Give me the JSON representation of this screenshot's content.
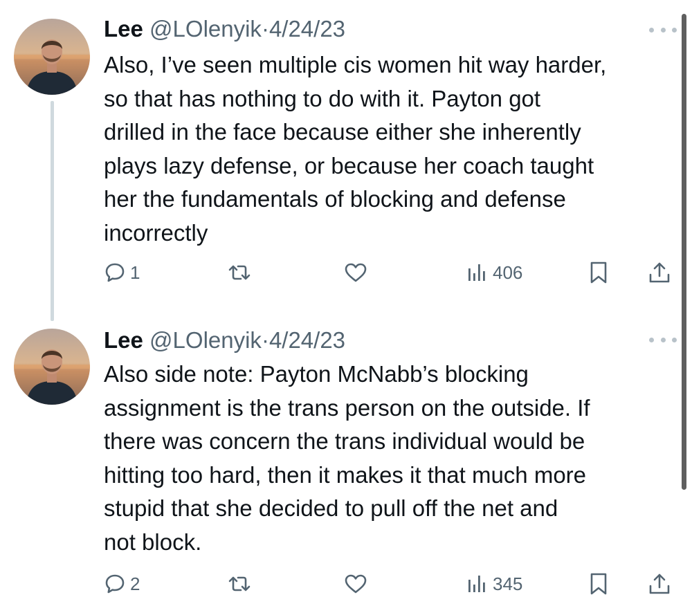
{
  "tweets": [
    {
      "author": {
        "name": "Lee",
        "handle": "@LOlenyik",
        "separator": "·",
        "date": "4/24/23"
      },
      "text": "Also, I’ve seen multiple cis women hit way harder,\nso that has nothing to do with it. Payton got\ndrilled in the face because either she inherently\nplays lazy defense, or because her coach taught\nher the fundamentals of blocking and defense\nincorrectly",
      "stats": {
        "replies": "1",
        "views": "406"
      }
    },
    {
      "author": {
        "name": "Lee",
        "handle": "@LOlenyik",
        "separator": "·",
        "date": "4/24/23"
      },
      "text": "Also side note: Payton McNabb’s blocking\nassignment is the trans person on the outside. If\nthere was concern the trans individual would be\nhitting too hard, then it makes it that much more\nstupid that she decided to pull off the net and\nnot block.",
      "stats": {
        "replies": "2",
        "views": "345"
      }
    }
  ],
  "icons": {
    "reply": "speech-bubble-icon",
    "retweet": "retweet-arrows-icon",
    "like": "heart-outline-icon",
    "views": "bar-chart-icon",
    "bookmark": "bookmark-outline-icon",
    "share": "share-upload-icon",
    "more": "more-horizontal-dots-icon"
  },
  "colors": {
    "text_primary": "#0f1419",
    "text_secondary": "#536471",
    "thread_line": "#cfd9de",
    "background": "#ffffff"
  }
}
